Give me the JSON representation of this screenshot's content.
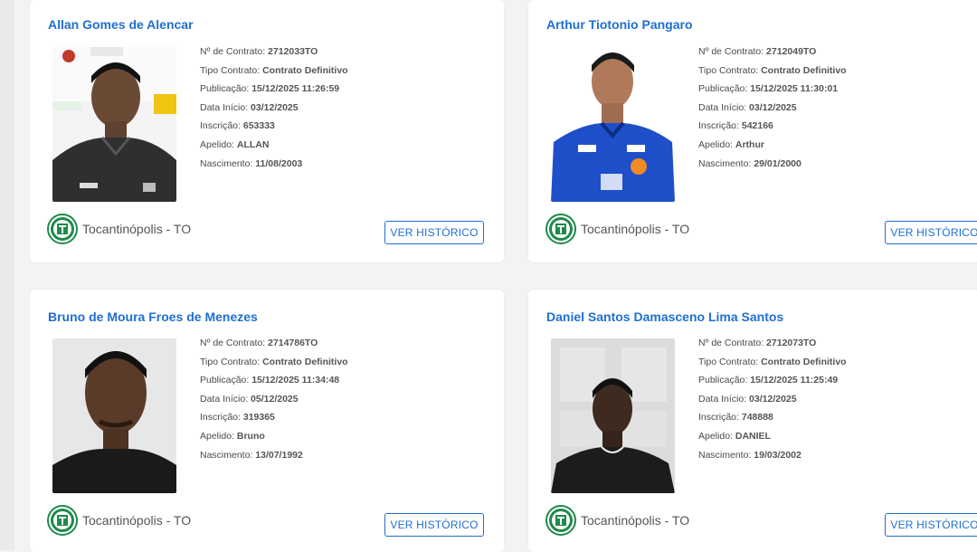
{
  "cards": [
    {
      "name": "Allan Gomes de Alencar",
      "contrato_label": "Nº de Contrato:",
      "contrato": "2712033TO",
      "tipo_label": "Tipo Contrato:",
      "tipo": "Contrato Definitivo",
      "publicacao_label": "Publicação:",
      "publicacao": "15/12/2025 11:26:59",
      "inicio_label": "Data Início:",
      "inicio": "03/12/2025",
      "inscricao_label": "Inscrição:",
      "inscricao": "653333",
      "apelido_label": "Apelido:",
      "apelido": "ALLAN",
      "nascimento_label": "Nascimento:",
      "nascimento": "11/08/2003",
      "club": "Tocantinópolis - TO",
      "button": "VER HISTÓRICO"
    },
    {
      "name": "Arthur Tiotonio Pangaro",
      "contrato_label": "Nº de Contrato:",
      "contrato": "2712049TO",
      "tipo_label": "Tipo Contrato:",
      "tipo": "Contrato Definitivo",
      "publicacao_label": "Publicação:",
      "publicacao": "15/12/2025 11:30:01",
      "inicio_label": "Data Início:",
      "inicio": "03/12/2025",
      "inscricao_label": "Inscrição:",
      "inscricao": "542166",
      "apelido_label": "Apelido:",
      "apelido": "Arthur",
      "nascimento_label": "Nascimento:",
      "nascimento": "29/01/2000",
      "club": "Tocantinópolis - TO",
      "button": "VER HISTÓRICO"
    },
    {
      "name": "Bruno de Moura Froes de Menezes",
      "contrato_label": "Nº de Contrato:",
      "contrato": "2714786TO",
      "tipo_label": "Tipo Contrato:",
      "tipo": "Contrato Definitivo",
      "publicacao_label": "Publicação:",
      "publicacao": "15/12/2025 11:34:48",
      "inicio_label": "Data Início:",
      "inicio": "05/12/2025",
      "inscricao_label": "Inscrição:",
      "inscricao": "319365",
      "apelido_label": "Apelido:",
      "apelido": "Bruno",
      "nascimento_label": "Nascimento:",
      "nascimento": "13/07/1992",
      "club": "Tocantinópolis - TO",
      "button": "VER HISTÓRICO"
    },
    {
      "name": "Daniel Santos Damasceno Lima Santos",
      "contrato_label": "Nº de Contrato:",
      "contrato": "2712073TO",
      "tipo_label": "Tipo Contrato:",
      "tipo": "Contrato Definitivo",
      "publicacao_label": "Publicação:",
      "publicacao": "15/12/2025 11:25:49",
      "inicio_label": "Data Início:",
      "inicio": "03/12/2025",
      "inscricao_label": "Inscrição:",
      "inscricao": "748888",
      "apelido_label": "Apelido:",
      "apelido": "DANIEL",
      "nascimento_label": "Nascimento:",
      "nascimento": "19/03/2002",
      "club": "Tocantinópolis - TO",
      "button": "VER HISTÓRICO"
    }
  ],
  "colors": {
    "link_blue": "#1f6fd1",
    "club_green": "#1f8a4c"
  },
  "icons": {
    "club_logo": "tocantinopolis-crest-icon",
    "photo": "player-photo"
  }
}
